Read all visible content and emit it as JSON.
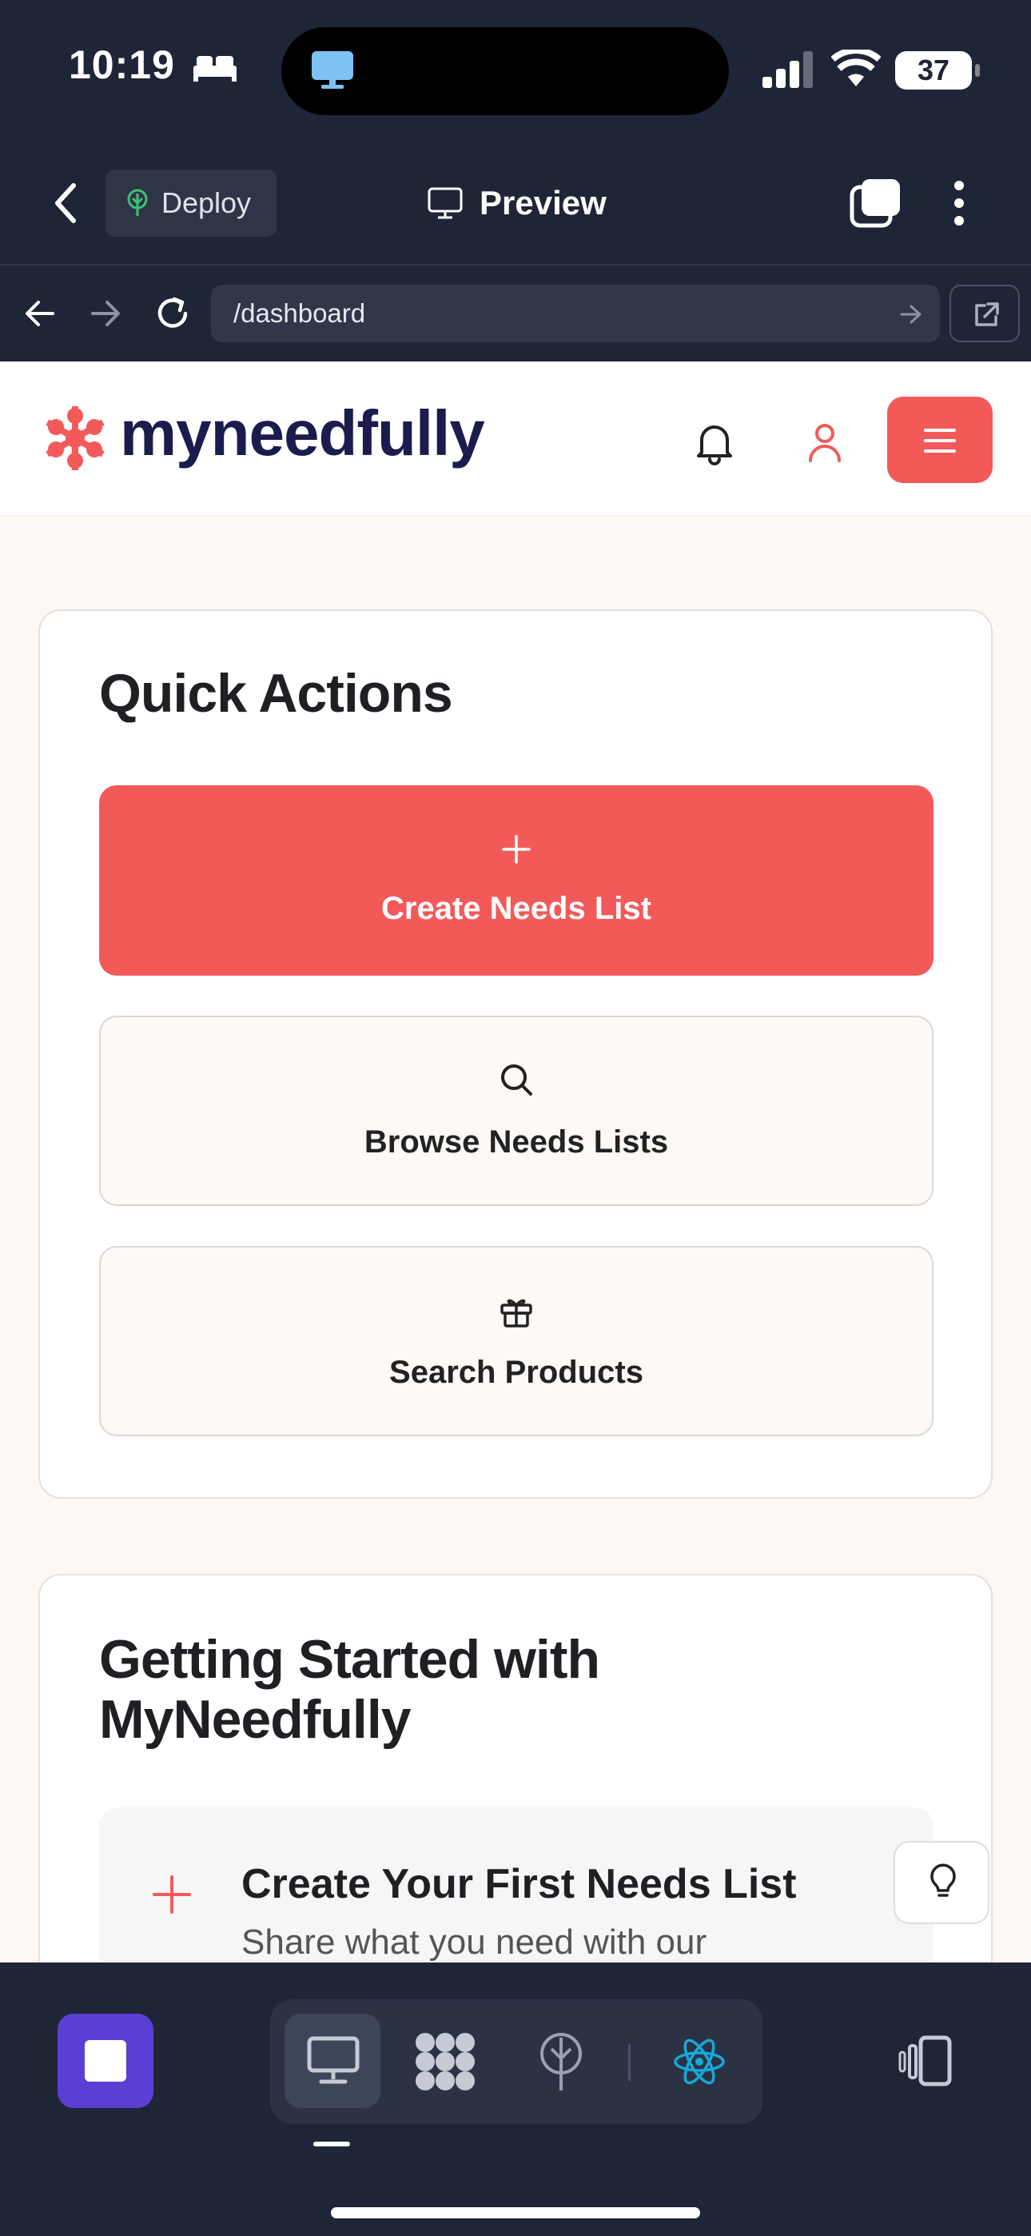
{
  "status_bar": {
    "time": "10:19",
    "battery": "37"
  },
  "app_bar": {
    "deploy_label": "Deploy",
    "title": "Preview"
  },
  "browser": {
    "url": "/dashboard"
  },
  "site": {
    "logo_text": "myneedfully"
  },
  "quick_actions": {
    "title": "Quick Actions",
    "actions": [
      {
        "label": "Create Needs List",
        "icon": "plus-icon"
      },
      {
        "label": "Browse Needs Lists",
        "icon": "search-icon"
      },
      {
        "label": "Search Products",
        "icon": "gift-icon"
      }
    ]
  },
  "getting_started": {
    "title": "Getting Started with MyNeedfully",
    "step_title": "Create Your First Needs List",
    "step_desc": "Share what you need with our"
  },
  "colors": {
    "accent": "#f25a5a",
    "brand_navy": "#1c1b4d",
    "chrome_bg": "#1e2536",
    "stop_purple": "#5b3fd4",
    "react_blue": "#17a8d8"
  }
}
